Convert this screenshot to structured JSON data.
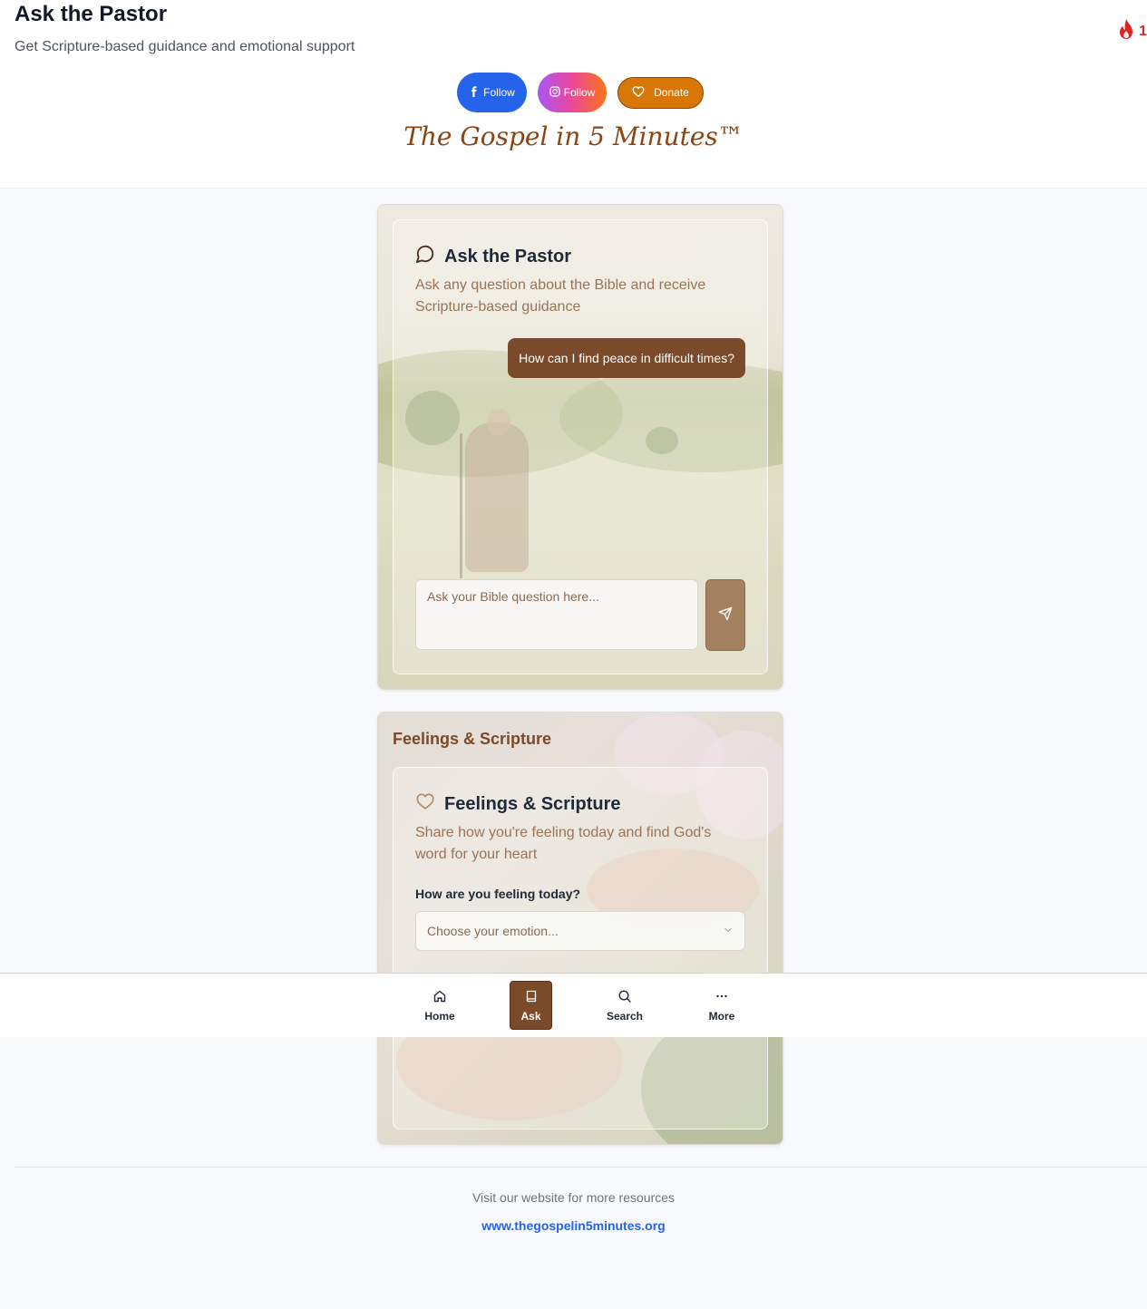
{
  "header": {
    "title": "Ask the Pastor",
    "subtitle": "Get Scripture-based guidance and emotional support",
    "streak_count": "1",
    "streak_icon": "flame-icon"
  },
  "social": {
    "facebook_label": "Follow",
    "instagram_label": "Follow",
    "donate_label": "Donate"
  },
  "brand": {
    "name": "The Gospel in 5 Minutes™"
  },
  "ask_card": {
    "title": "Ask the Pastor",
    "description": "Ask any question about the Bible and receive Scripture-based guidance",
    "sample_question": "How can I find peace in difficult times?",
    "input_placeholder": "Ask your Bible question here...",
    "icon": "message-circle-icon"
  },
  "feelings_card": {
    "section_title": "Feelings & Scripture",
    "title": "Feelings & Scripture",
    "description": "Share how you're feeling today and find God's word for your heart",
    "question_label": "How are you feeling today?",
    "select_placeholder": "Choose your emotion...",
    "icon": "heart-icon"
  },
  "nav": {
    "items": [
      {
        "label": "Home",
        "icon": "home-icon"
      },
      {
        "label": "Ask",
        "icon": "book-icon",
        "active": true
      },
      {
        "label": "Search",
        "icon": "search-icon"
      },
      {
        "label": "More",
        "icon": "more-horizontal-icon"
      }
    ]
  },
  "footer": {
    "text": "Visit our website for more resources",
    "link": "www.thegospelin5minutes.org"
  },
  "colors": {
    "brand_brown": "#7a4a2a",
    "facebook_blue": "#2563eb",
    "donate_orange": "#d97706",
    "streak_red": "#dc2626",
    "link_blue": "#2563eb"
  }
}
